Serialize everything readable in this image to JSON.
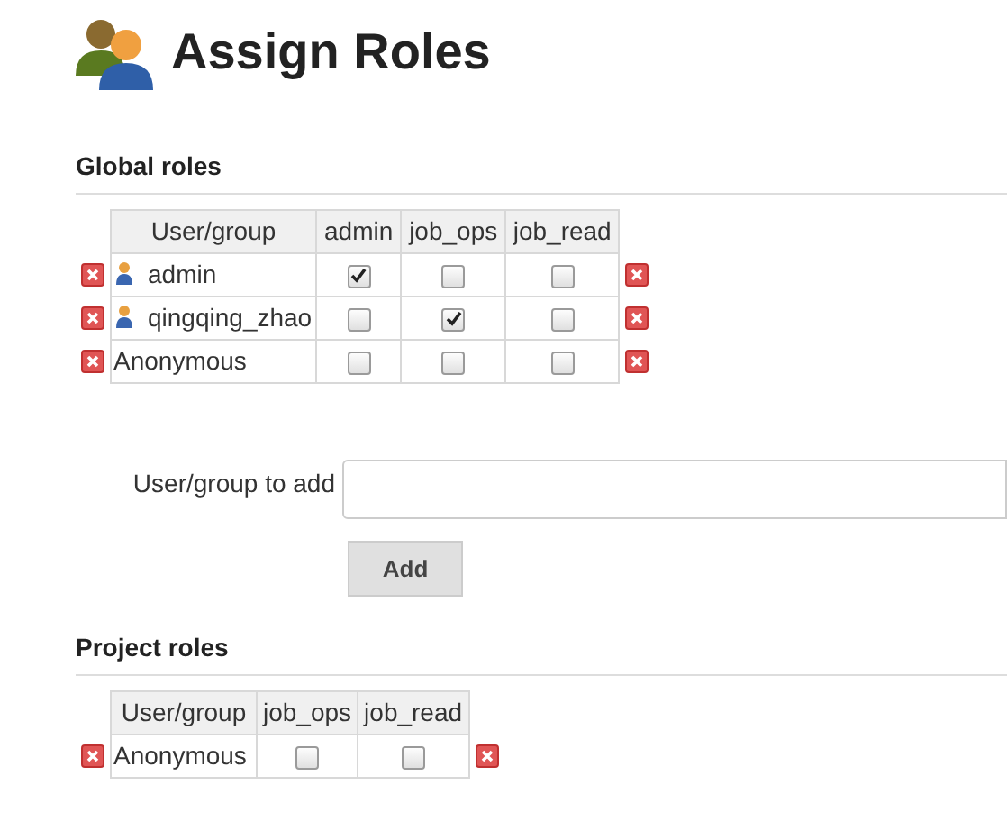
{
  "page": {
    "title": "Assign Roles"
  },
  "global_roles": {
    "heading": "Global roles",
    "columns": [
      "User/group",
      "admin",
      "job_ops",
      "job_read"
    ],
    "rows": [
      {
        "name": "admin",
        "kind": "user",
        "checks": [
          true,
          false,
          false
        ]
      },
      {
        "name": "qingqing_zhao",
        "kind": "user",
        "checks": [
          false,
          true,
          false
        ]
      },
      {
        "name": "Anonymous",
        "kind": "group",
        "checks": [
          false,
          false,
          false
        ]
      }
    ]
  },
  "add_form": {
    "label": "User/group to add",
    "button": "Add"
  },
  "project_roles": {
    "heading": "Project roles",
    "columns": [
      "User/group",
      "job_ops",
      "job_read"
    ],
    "rows": [
      {
        "name": "Anonymous",
        "kind": "group",
        "checks": [
          false,
          false
        ]
      }
    ]
  }
}
